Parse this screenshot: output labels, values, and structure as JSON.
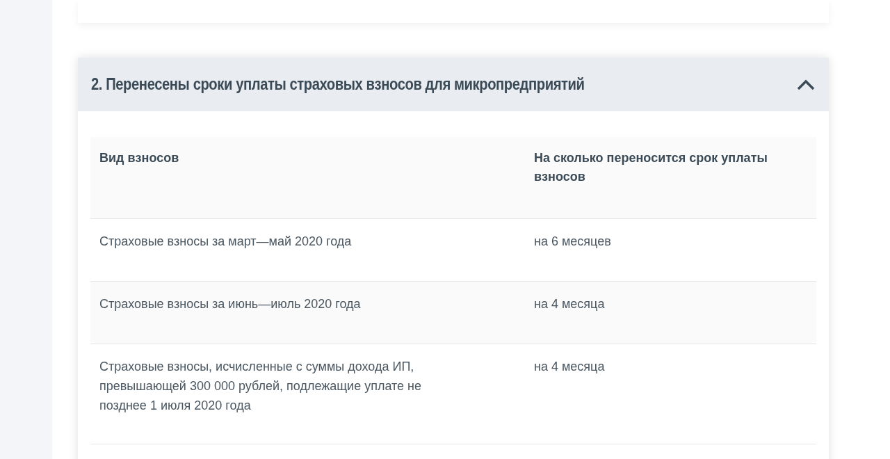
{
  "section": {
    "title": "2. Перенесены сроки уплаты страховых взносов для микропредприятий",
    "expanded": true
  },
  "table": {
    "columns": [
      "Вид взносов",
      "На сколько переносится срок уплаты взносов"
    ],
    "rows": [
      {
        "cells": [
          "Страховые взносы за март—май 2020 года",
          "на 6 месяцев"
        ]
      },
      {
        "cells": [
          "Страховые взносы за июнь—июль 2020 года",
          "на 4 месяца"
        ]
      },
      {
        "cells": [
          "Страховые взносы, исчисленные с суммы дохода ИП, превышающей 300 000 рублей, подлежащие уплате не позднее 1 июля 2020 года",
          "на 4 месяца"
        ]
      }
    ]
  }
}
